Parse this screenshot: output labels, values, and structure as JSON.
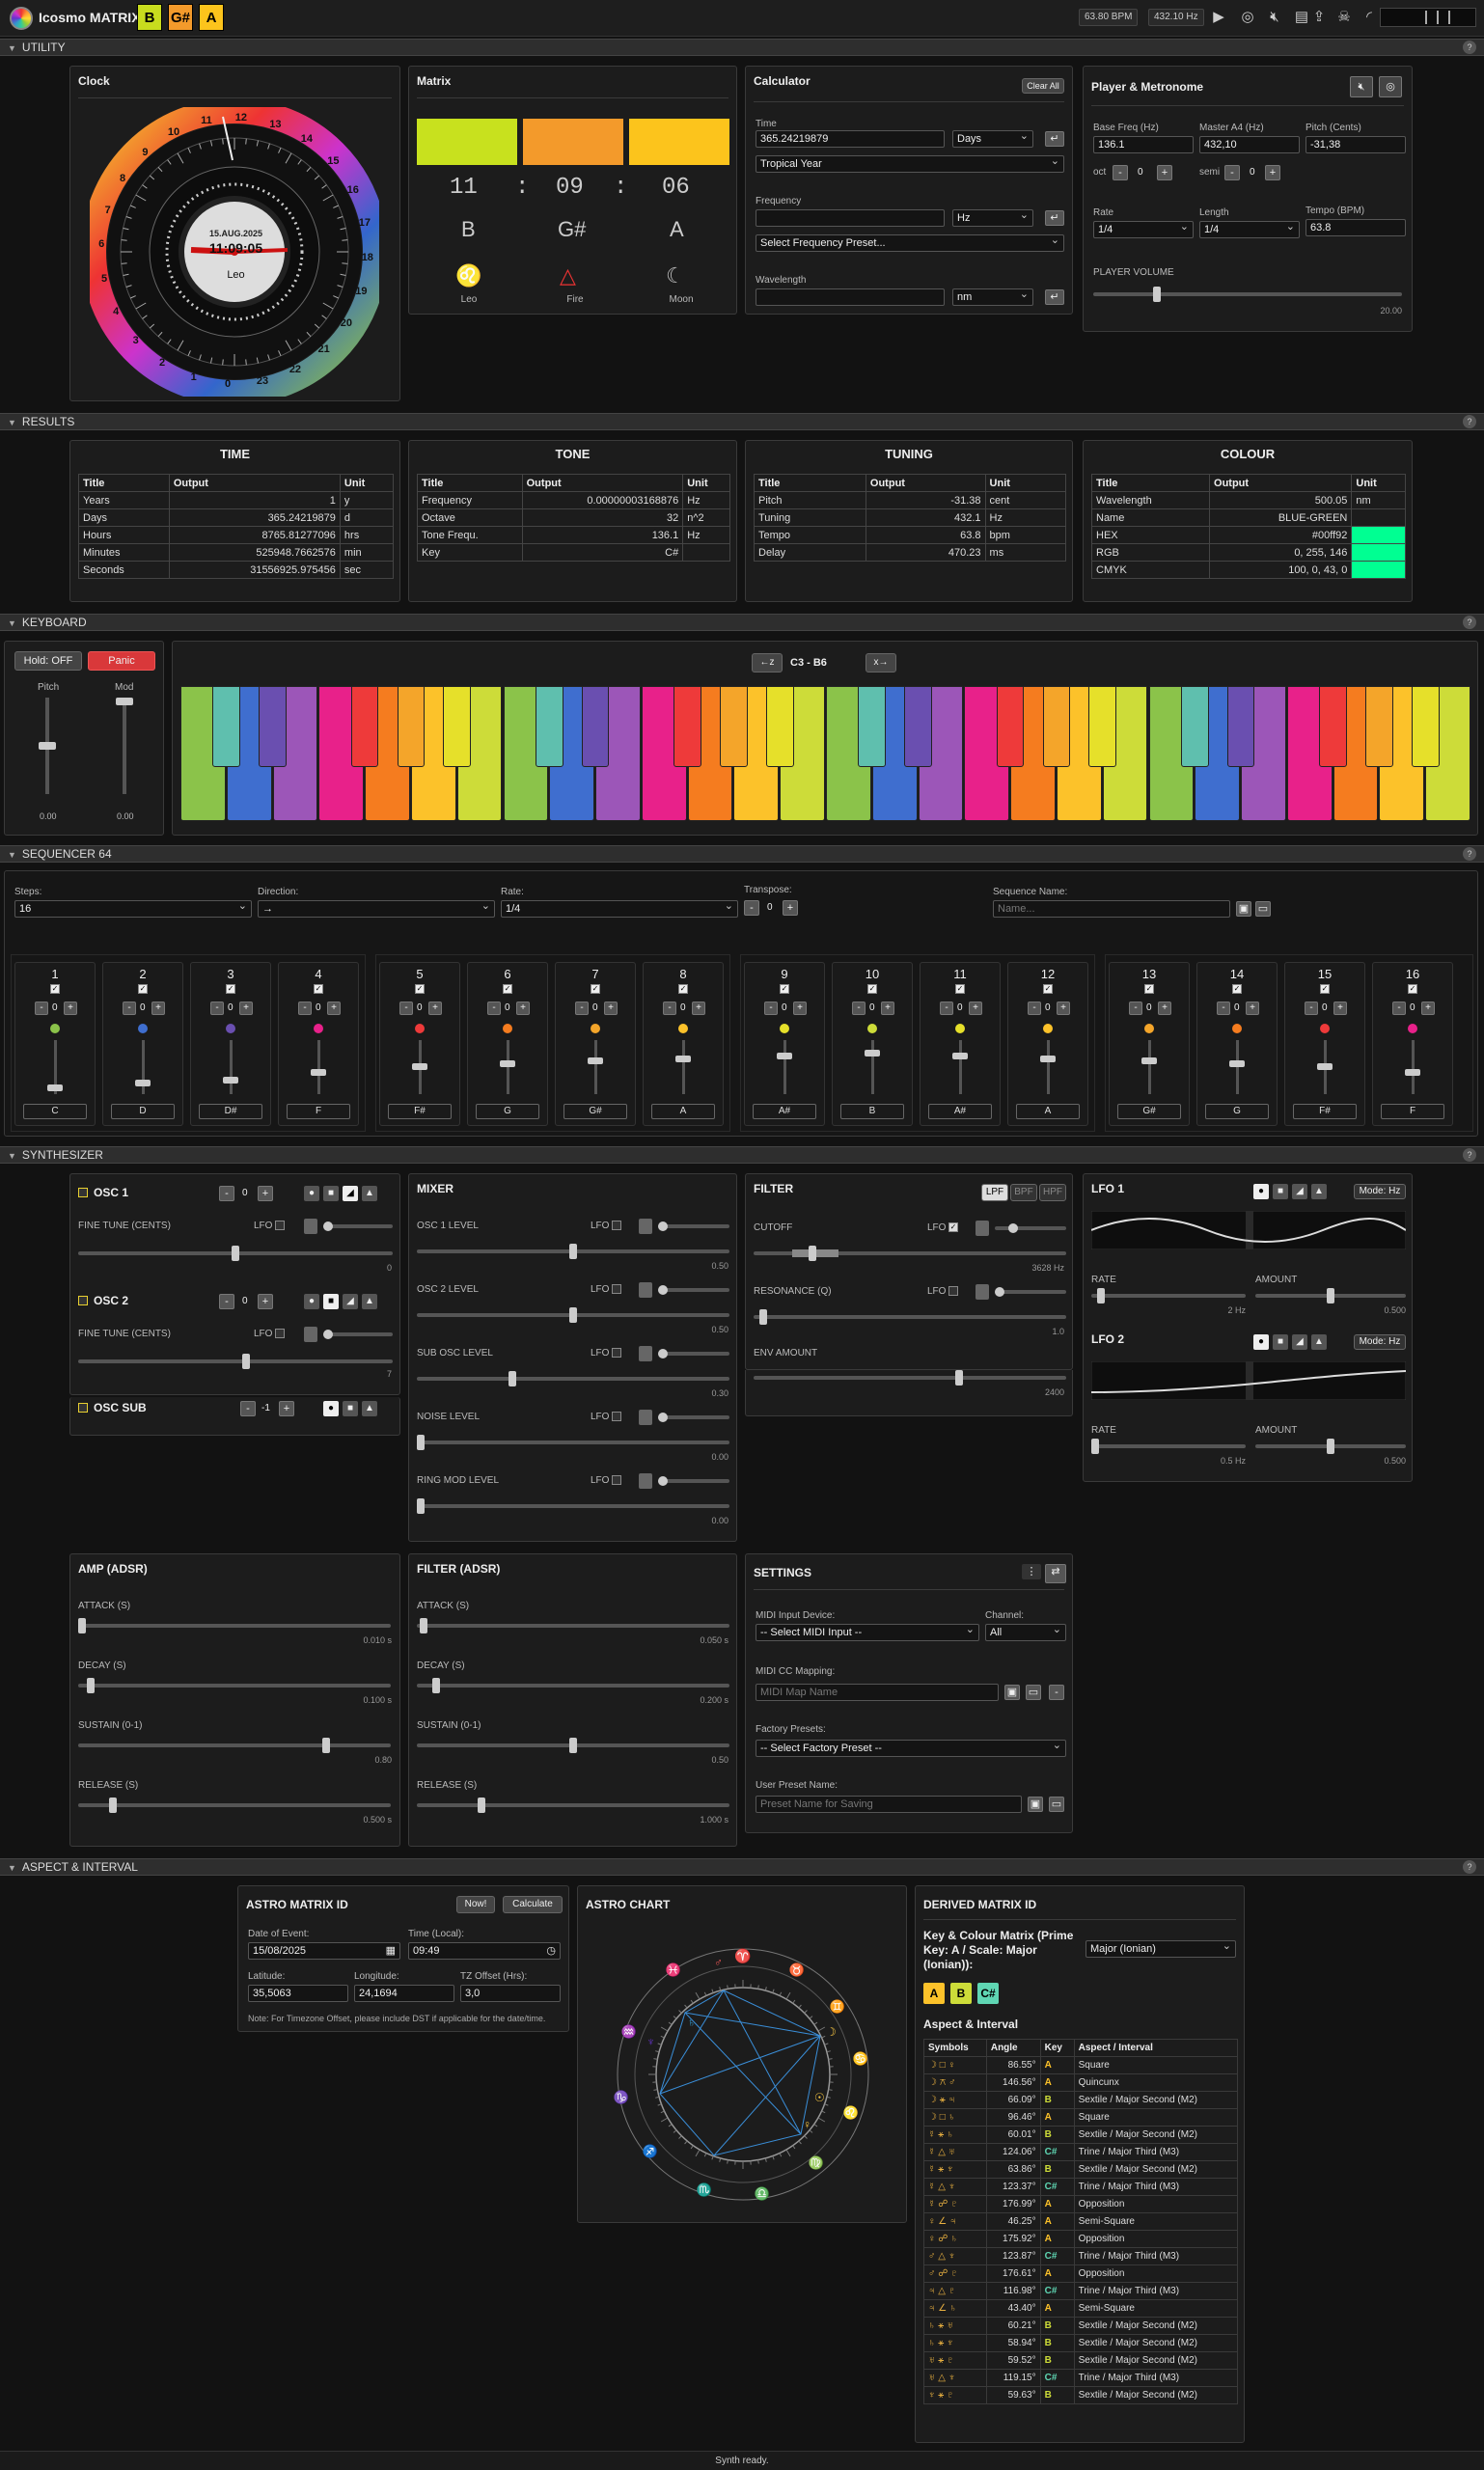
{
  "app": {
    "title": "Icosmo MATRIX",
    "keys": [
      {
        "label": "B",
        "color": "#c8dc1e"
      },
      {
        "label": "G#",
        "color": "#f39a2b"
      },
      {
        "label": "A",
        "color": "#fcc41c"
      }
    ],
    "bpm": "63.80 BPM",
    "hz": "432.10 Hz"
  },
  "sections": {
    "utility": "UTILITY",
    "results": "RESULTS",
    "keyboard": "KEYBOARD",
    "sequencer": "SEQUENCER 64",
    "synth": "SYNTHESIZER",
    "aspect": "ASPECT & INTERVAL",
    "help": "?"
  },
  "clock": {
    "title": "Clock",
    "date": "15.AUG.2025",
    "time": "11:09:05",
    "sign": "Leo",
    "hours": [
      "12",
      "13",
      "14",
      "15",
      "16",
      "17",
      "18",
      "19",
      "20",
      "21",
      "22",
      "23",
      "0",
      "1",
      "2",
      "3",
      "4",
      "5",
      "6",
      "7",
      "8",
      "9",
      "10",
      "11"
    ]
  },
  "matrix": {
    "title": "Matrix",
    "colors": [
      "#c8e11e",
      "#f39a2b",
      "#fcc41c"
    ],
    "time": [
      "11",
      ":",
      "09",
      ":",
      "06"
    ],
    "notes": [
      "B",
      "G#",
      "A"
    ],
    "symbols": [
      {
        "glyph": "♌",
        "label": "Leo"
      },
      {
        "glyph": "△",
        "label": "Fire"
      },
      {
        "glyph": "☾",
        "label": "Moon"
      }
    ]
  },
  "calculator": {
    "title": "Calculator",
    "clear": "Clear All",
    "time_label": "Time",
    "time_value": "365.24219879",
    "time_unit": "Days",
    "year_type": "Tropical Year",
    "freq_label": "Frequency",
    "freq_unit": "Hz",
    "freq_preset": "Select Frequency Preset...",
    "wave_label": "Wavelength",
    "wave_unit": "nm"
  },
  "player": {
    "title": "Player & Metronome",
    "base_label": "Base Freq (Hz)",
    "base": "136.1",
    "master_label": "Master A4 (Hz)",
    "master": "432,10",
    "pitch_label": "Pitch (Cents)",
    "pitch": "-31,38",
    "oct_label": "oct",
    "oct": "0",
    "semi_label": "semi",
    "semi": "0",
    "rate_label": "Rate",
    "rate": "1/4",
    "length_label": "Length",
    "length": "1/4",
    "tempo_label": "Tempo (BPM)",
    "tempo": "63.8",
    "volume_label": "PLAYER VOLUME",
    "volume_val": "20.00",
    "volume_level": 0.2
  },
  "results": {
    "headers": {
      "title": "Title",
      "output": "Output",
      "unit": "Unit"
    },
    "time": {
      "title": "TIME",
      "rows": [
        [
          "Years",
          "1",
          "y"
        ],
        [
          "Days",
          "365.24219879",
          "d"
        ],
        [
          "Hours",
          "8765.81277096",
          "hrs"
        ],
        [
          "Minutes",
          "525948.7662576",
          "min"
        ],
        [
          "Seconds",
          "31556925.975456",
          "sec"
        ]
      ]
    },
    "tone": {
      "title": "TONE",
      "rows": [
        [
          "Frequency",
          "0.00000003168876",
          "Hz"
        ],
        [
          "Octave",
          "32",
          "n^2"
        ],
        [
          "Tone Frequ.",
          "136.1",
          "Hz"
        ],
        [
          "Key",
          "C#",
          ""
        ]
      ]
    },
    "tuning": {
      "title": "TUNING",
      "rows": [
        [
          "Pitch",
          "-31.38",
          "cent"
        ],
        [
          "Tuning",
          "432.1",
          "Hz"
        ],
        [
          "Tempo",
          "63.8",
          "bpm"
        ],
        [
          "Delay",
          "470.23",
          "ms"
        ]
      ]
    },
    "colour": {
      "title": "COLOUR",
      "swatch": "#00ff92",
      "rows": [
        [
          "Wavelength",
          "500.05",
          "nm"
        ],
        [
          "Name",
          "BLUE-GREEN",
          ""
        ],
        [
          "HEX",
          "#00ff92",
          ""
        ],
        [
          "RGB",
          "0, 255, 146",
          ""
        ],
        [
          "CMYK",
          "100, 0, 43, 0",
          ""
        ]
      ]
    }
  },
  "keyboard": {
    "hold": "Hold: OFF",
    "panic": "Panic",
    "pitch": "Pitch",
    "mod": "Mod",
    "pitch_val": "0.00",
    "mod_val": "0.00",
    "down": "←z",
    "up": "x→",
    "range": "C3 - B6",
    "white": [
      "#8bc34a",
      "#3f6ecf",
      "#9c56b8",
      "#e8218a",
      "#f57c1f",
      "#fcc22a",
      "#cddc39"
    ],
    "black": [
      "#5fbfae",
      "#6a4fb0",
      "#ee3a3a",
      "#f4a52a",
      "#e6e02a"
    ]
  },
  "sequencer": {
    "steps_label": "Steps:",
    "steps": "16",
    "dir_label": "Direction:",
    "dir": "→",
    "rate_label": "Rate:",
    "rate": "1/4",
    "transpose_label": "Transpose:",
    "transpose": "0",
    "name_label": "Sequence Name:",
    "name_ph": "Name...",
    "steps_data": [
      {
        "n": "1",
        "note": "C",
        "color": "#8bc34a",
        "level": 0.1
      },
      {
        "n": "2",
        "note": "D",
        "color": "#3f6ecf",
        "level": 0.2
      },
      {
        "n": "3",
        "note": "D#",
        "color": "#6a4fb0",
        "level": 0.25
      },
      {
        "n": "4",
        "note": "F",
        "color": "#e8218a",
        "level": 0.4
      },
      {
        "n": "5",
        "note": "F#",
        "color": "#ee3a3a",
        "level": 0.5
      },
      {
        "n": "6",
        "note": "G",
        "color": "#f57c1f",
        "level": 0.55
      },
      {
        "n": "7",
        "note": "G#",
        "color": "#f4a52a",
        "level": 0.6
      },
      {
        "n": "8",
        "note": "A",
        "color": "#fcc22a",
        "level": 0.65
      },
      {
        "n": "9",
        "note": "A#",
        "color": "#e6e02a",
        "level": 0.7
      },
      {
        "n": "10",
        "note": "B",
        "color": "#cddc39",
        "level": 0.75
      },
      {
        "n": "11",
        "note": "A#",
        "color": "#e6e02a",
        "level": 0.7
      },
      {
        "n": "12",
        "note": "A",
        "color": "#fcc22a",
        "level": 0.65
      },
      {
        "n": "13",
        "note": "G#",
        "color": "#f4a52a",
        "level": 0.6
      },
      {
        "n": "14",
        "note": "G",
        "color": "#f57c1f",
        "level": 0.55
      },
      {
        "n": "15",
        "note": "F#",
        "color": "#ee3a3a",
        "level": 0.5
      },
      {
        "n": "16",
        "note": "F",
        "color": "#e8218a",
        "level": 0.4
      }
    ]
  },
  "synth": {
    "osc1": {
      "title": "OSC 1",
      "val": "0",
      "fine": "FINE TUNE (CENTS)",
      "fine_val": "0",
      "level": 0.5
    },
    "osc2": {
      "title": "OSC 2",
      "val": "0",
      "fine": "FINE TUNE (CENTS)",
      "fine_val": "7",
      "level": 0.535
    },
    "oscsub": {
      "title": "OSC SUB",
      "val": "-1"
    },
    "lfo": "LFO",
    "mixer": {
      "title": "MIXER",
      "items": [
        {
          "label": "OSC 1 LEVEL",
          "val": "0.50",
          "level": 0.5
        },
        {
          "label": "OSC 2 LEVEL",
          "val": "0.50",
          "level": 0.5
        },
        {
          "label": "SUB OSC LEVEL",
          "val": "0.30",
          "level": 0.3
        },
        {
          "label": "NOISE LEVEL",
          "val": "0.00",
          "level": 0
        },
        {
          "label": "RING MOD LEVEL",
          "val": "0.00",
          "level": 0
        }
      ]
    },
    "filter": {
      "title": "FILTER",
      "types": [
        "LPF",
        "BPF",
        "HPF"
      ],
      "cutoff": "CUTOFF",
      "cutoff_val": "3628 Hz",
      "cutoff_level": 0.18,
      "res": "RESONANCE (Q)",
      "res_val": "1.0",
      "res_level": 0.02,
      "env": "ENV AMOUNT",
      "env_val": "2400",
      "env_level": 0.66
    },
    "lfo1": {
      "title": "LFO 1",
      "mode": "Mode: Hz",
      "rate": "RATE",
      "rate_val": "2 Hz",
      "rate_level": 0.04,
      "amount": "AMOUNT",
      "amount_val": "0.500",
      "amount_level": 0.5
    },
    "lfo2": {
      "title": "LFO 2",
      "mode": "Mode: Hz",
      "rate": "RATE",
      "rate_val": "0.5 Hz",
      "rate_level": 0.0,
      "amount": "AMOUNT",
      "amount_val": "0.500",
      "amount_level": 0.5
    },
    "amp": {
      "title": "AMP (ADSR)",
      "items": [
        {
          "label": "ATTACK (S)",
          "val": "0.010 s",
          "level": 0.0
        },
        {
          "label": "DECAY (S)",
          "val": "0.100 s",
          "level": 0.03
        },
        {
          "label": "SUSTAIN (0-1)",
          "val": "0.80",
          "level": 0.8
        },
        {
          "label": "RELEASE (S)",
          "val": "0.500 s",
          "level": 0.1
        }
      ]
    },
    "fenv": {
      "title": "FILTER (ADSR)",
      "items": [
        {
          "label": "ATTACK (S)",
          "val": "0.050 s",
          "level": 0.01
        },
        {
          "label": "DECAY (S)",
          "val": "0.200 s",
          "level": 0.05
        },
        {
          "label": "SUSTAIN (0-1)",
          "val": "0.50",
          "level": 0.5
        },
        {
          "label": "RELEASE (S)",
          "val": "1.000 s",
          "level": 0.2
        }
      ]
    },
    "settings": {
      "title": "SETTINGS",
      "midi_in": "MIDI Input Device:",
      "midi_sel": "-- Select MIDI Input --",
      "channel": "Channel:",
      "channel_val": "All",
      "cc": "MIDI CC Mapping:",
      "cc_ph": "MIDI Map Name",
      "factory": "Factory Presets:",
      "factory_sel": "-- Select Factory Preset --",
      "user": "User Preset Name:",
      "user_ph": "Preset Name for Saving"
    }
  },
  "astro": {
    "title": "ASTRO MATRIX ID",
    "now": "Now!",
    "calc": "Calculate",
    "date_label": "Date of Event:",
    "date": "15/08/2025",
    "time_label": "Time (Local):",
    "time": "09:49",
    "lat_label": "Latitude:",
    "lat": "35,5063",
    "lon_label": "Longitude:",
    "lon": "24,1694",
    "tz_label": "TZ Offset (Hrs):",
    "tz": "3,0",
    "note": "Note: For Timezone Offset, please include DST if applicable for the date/time."
  },
  "astro_chart": {
    "title": "ASTRO CHART"
  },
  "derived": {
    "title": "DERIVED MATRIX ID",
    "key_label": "Key & Colour Matrix (Prime Key: A / Scale: Major (Ionian)):",
    "scale": "Major (Ionian)",
    "badges": [
      {
        "label": "A",
        "color": "#fcc22a"
      },
      {
        "label": "B",
        "color": "#cddc39"
      },
      {
        "label": "C#",
        "color": "#5fd6b3"
      }
    ],
    "aspect_title": "Aspect & Interval",
    "headers": [
      "Symbols",
      "Angle",
      "Key",
      "Aspect / Interval"
    ],
    "rows": [
      [
        "☽ □ ♀",
        "86.55°",
        "A",
        "Square",
        "#fcc22a"
      ],
      [
        "☽ ⚻ ♂",
        "146.56°",
        "A",
        "Quincunx",
        "#fcc22a"
      ],
      [
        "☽ ⚹ ♃",
        "66.09°",
        "B",
        "Sextile / Major Second (M2)",
        "#cddc39"
      ],
      [
        "☽ □ ♄",
        "96.46°",
        "A",
        "Square",
        "#fcc22a"
      ],
      [
        "☿ ⚹ ♄",
        "60.01°",
        "B",
        "Sextile / Major Second (M2)",
        "#cddc39"
      ],
      [
        "☿ △ ♅",
        "124.06°",
        "C#",
        "Trine / Major Third (M3)",
        "#5fd6b3"
      ],
      [
        "☿ ⚹ ♆",
        "63.86°",
        "B",
        "Sextile / Major Second (M2)",
        "#cddc39"
      ],
      [
        "☿ △ ♆",
        "123.37°",
        "C#",
        "Trine / Major Third (M3)",
        "#5fd6b3"
      ],
      [
        "☿ ☍ ♇",
        "176.99°",
        "A",
        "Opposition",
        "#fcc22a"
      ],
      [
        "♀ ∠ ♃",
        "46.25°",
        "A",
        "Semi-Square",
        "#fcc22a"
      ],
      [
        "♀ ☍ ♄",
        "175.92°",
        "A",
        "Opposition",
        "#fcc22a"
      ],
      [
        "♂ △ ♆",
        "123.87°",
        "C#",
        "Trine / Major Third (M3)",
        "#5fd6b3"
      ],
      [
        "♂ ☍ ♇",
        "176.61°",
        "A",
        "Opposition",
        "#fcc22a"
      ],
      [
        "♃ △ ♇",
        "116.98°",
        "C#",
        "Trine / Major Third (M3)",
        "#5fd6b3"
      ],
      [
        "♃ ∠ ♄",
        "43.40°",
        "A",
        "Semi-Square",
        "#fcc22a"
      ],
      [
        "♄ ⚹ ♅",
        "60.21°",
        "B",
        "Sextile / Major Second (M2)",
        "#cddc39"
      ],
      [
        "♄ ⚹ ♆",
        "58.94°",
        "B",
        "Sextile / Major Second (M2)",
        "#cddc39"
      ],
      [
        "♅ ⚹ ♇",
        "59.52°",
        "B",
        "Sextile / Major Second (M2)",
        "#cddc39"
      ],
      [
        "♅ △ ♆",
        "119.15°",
        "C#",
        "Trine / Major Third (M3)",
        "#5fd6b3"
      ],
      [
        "♆ ⚹ ♇",
        "59.63°",
        "B",
        "Sextile / Major Second (M2)",
        "#cddc39"
      ]
    ]
  },
  "status": "Synth ready."
}
